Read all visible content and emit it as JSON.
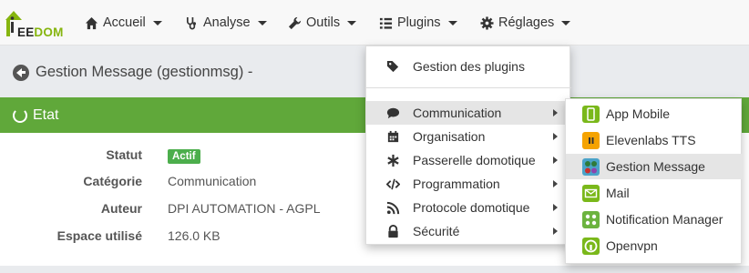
{
  "logo": {
    "text_prefix": "EE",
    "text_suffix": "DOM"
  },
  "nav": [
    {
      "label": "Accueil",
      "icon": "home-icon"
    },
    {
      "label": "Analyse",
      "icon": "stethoscope-icon"
    },
    {
      "label": "Outils",
      "icon": "wrench-icon"
    },
    {
      "label": "Plugins",
      "icon": "list-icon"
    },
    {
      "label": "Réglages",
      "icon": "gear-icon"
    }
  ],
  "page": {
    "title": "Gestion Message (gestionmsg) -"
  },
  "panel": {
    "heading": "Etat",
    "rows": [
      {
        "label": "Statut",
        "value": "Actif"
      },
      {
        "label": "Catégorie",
        "value": "Communication"
      },
      {
        "label": "Auteur",
        "value": "DPI AUTOMATION - AGPL"
      },
      {
        "label": "Espace utilisé",
        "value": "126.0 KB"
      }
    ]
  },
  "plugins_menu": {
    "manage": "Gestion des plugins",
    "categories": [
      {
        "label": "Communication",
        "icon": "comment-icon"
      },
      {
        "label": "Organisation",
        "icon": "calendar-icon"
      },
      {
        "label": "Passerelle domotique",
        "icon": "asterisk-icon"
      },
      {
        "label": "Programmation",
        "icon": "code-icon"
      },
      {
        "label": "Protocole domotique",
        "icon": "rss-icon"
      },
      {
        "label": "Sécurité",
        "icon": "lock-icon"
      }
    ]
  },
  "communication_menu": [
    {
      "label": "App Mobile",
      "color": "#7ab81a"
    },
    {
      "label": "Elevenlabs TTS",
      "color": "#f5a300"
    },
    {
      "label": "Gestion Message",
      "color": "#4aa3c9"
    },
    {
      "label": "Mail",
      "color": "#7ab81a"
    },
    {
      "label": "Notification Manager",
      "color": "#6cb33f"
    },
    {
      "label": "Openvpn",
      "color": "#7ab81a"
    }
  ]
}
